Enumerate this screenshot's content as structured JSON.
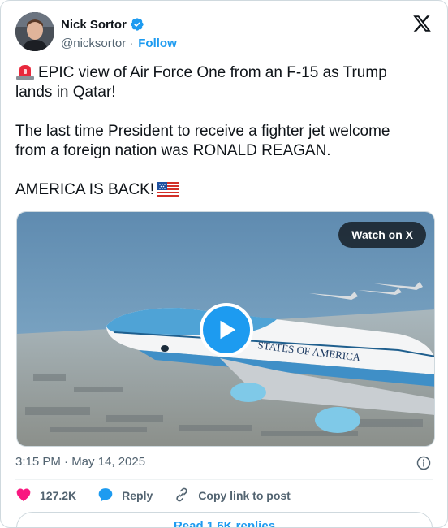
{
  "author": {
    "name": "Nick Sortor",
    "handle": "@nicksortor",
    "separator": "·",
    "follow_label": "Follow"
  },
  "icons": {
    "verified": "verified-badge-icon",
    "logo": "x-logo-icon",
    "siren": "rotating-light-emoji",
    "flag": "us-flag-emoji",
    "play": "play-icon",
    "info": "info-icon",
    "like": "heart-icon",
    "reply": "speech-bubble-icon",
    "copy": "link-icon"
  },
  "tweet": {
    "line1": "EPIC view of Air Force One from an F-15 as Trump lands in Qatar!",
    "line2": "The last time President to receive a fighter jet welcome from a foreign nation was RONALD REAGAN.",
    "line3": "AMERICA IS BACK!"
  },
  "media": {
    "watch_label": "Watch on X",
    "fuselage_text": "STATES OF AMERICA"
  },
  "meta": {
    "timestamp": "3:15 PM · May 14, 2025"
  },
  "actions": {
    "likes": "127.2K",
    "reply_label": "Reply",
    "copy_label": "Copy link to post"
  },
  "replies": {
    "label": "Read 1.6K replies"
  },
  "colors": {
    "accent": "#1d9bf0",
    "like": "#f91880",
    "text_secondary": "#536471"
  }
}
